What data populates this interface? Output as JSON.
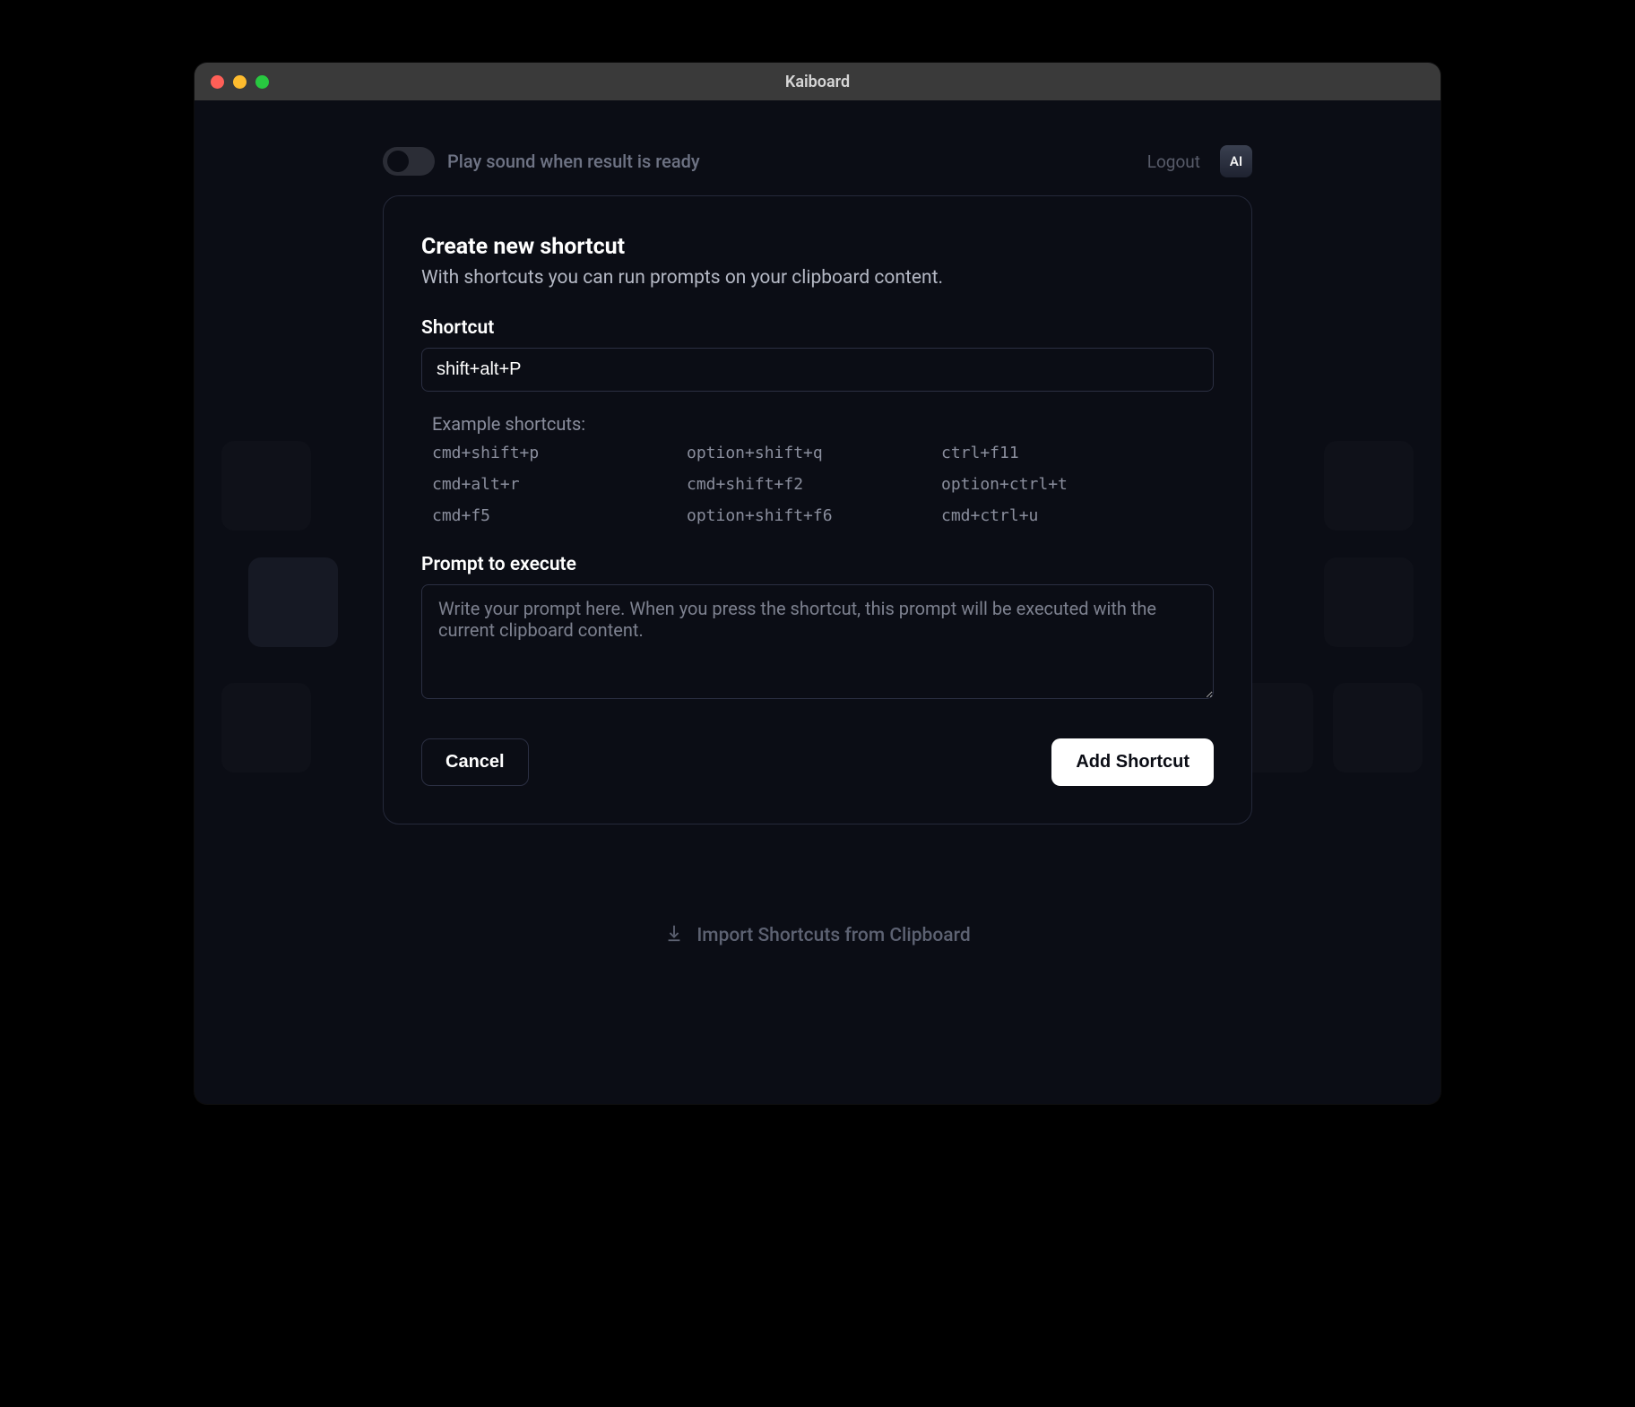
{
  "window": {
    "title": "Kaiboard"
  },
  "topbar": {
    "toggle_label": "Play sound when result is ready",
    "logout_label": "Logout",
    "avatar_text": "AI"
  },
  "card": {
    "title": "Create new shortcut",
    "subtitle": "With shortcuts you can run prompts on your clipboard content.",
    "shortcut_label": "Shortcut",
    "shortcut_value": "shift+alt+P",
    "examples_label": "Example shortcuts:",
    "examples": [
      "cmd+shift+p",
      "option+shift+q",
      "ctrl+f11",
      "cmd+alt+r",
      "cmd+shift+f2",
      "option+ctrl+t",
      "cmd+f5",
      "option+shift+f6",
      "cmd+ctrl+u"
    ],
    "prompt_label": "Prompt to execute",
    "prompt_placeholder": "Write your prompt here. When you press the shortcut, this prompt will be executed with the current clipboard content.",
    "cancel_label": "Cancel",
    "add_label": "Add Shortcut"
  },
  "footer": {
    "import_label": "Import Shortcuts from Clipboard"
  }
}
